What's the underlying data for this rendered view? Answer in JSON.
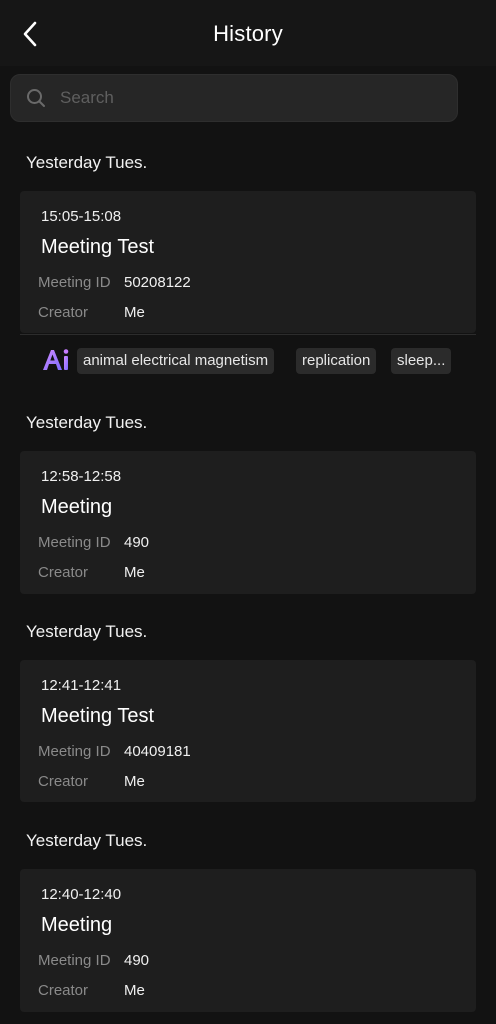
{
  "header": {
    "title": "History"
  },
  "search": {
    "placeholder": "Search"
  },
  "sections": [
    {
      "label": "Yesterday Tues.",
      "time": "15:05-15:08",
      "name": "Meeting Test",
      "id_label": "Meeting ID",
      "id": "50208122",
      "creator_label": "Creator",
      "creator": "Me",
      "tags": [
        "animal electrical magnetism",
        "replication",
        "sleep..."
      ]
    },
    {
      "label": "Yesterday Tues.",
      "time": "12:58-12:58",
      "name": "Meeting",
      "id_label": "Meeting ID",
      "id": "490",
      "creator_label": "Creator",
      "creator": "Me"
    },
    {
      "label": "Yesterday Tues.",
      "time": "12:41-12:41",
      "name": "Meeting Test",
      "id_label": "Meeting ID",
      "id": "40409181",
      "creator_label": "Creator",
      "creator": "Me"
    },
    {
      "label": "Yesterday Tues.",
      "time": "12:40-12:40",
      "name": "Meeting",
      "id_label": "Meeting ID",
      "id": "490",
      "creator_label": "Creator",
      "creator": "Me"
    }
  ],
  "colors": {
    "background": "#121212",
    "card": "#1e1e1e",
    "ai_gradient_start": "#c77dff",
    "ai_gradient_end": "#7b6cff"
  },
  "icons": {
    "back": "chevron-left-icon",
    "search": "search-icon",
    "ai": "ai-icon"
  }
}
